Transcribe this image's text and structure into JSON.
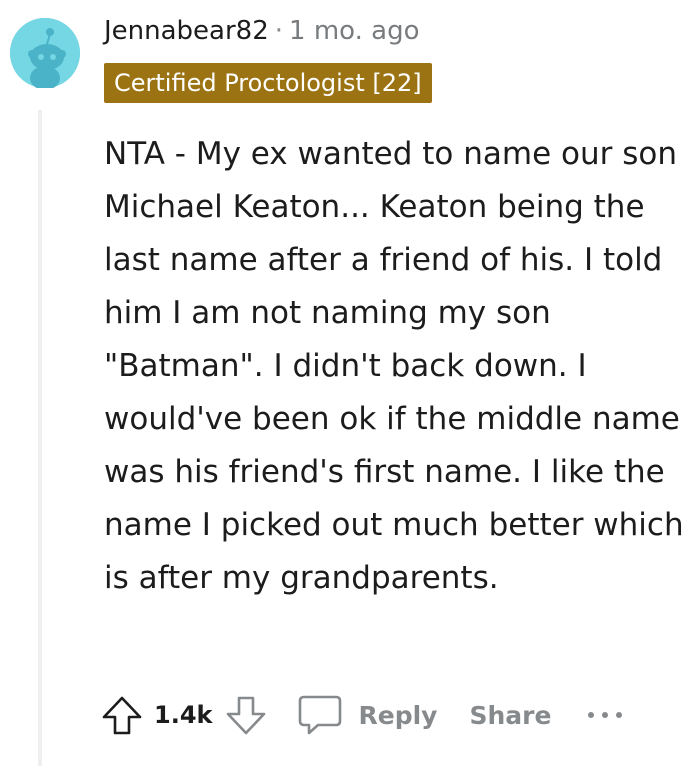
{
  "comment": {
    "username": "Jennabear82",
    "separator": "·",
    "timestamp": "1 mo. ago",
    "flair": "Certified Proctologist [22]",
    "body": "NTA - My ex wanted to name our son Michael Keaton... Keaton being the last name after a friend of his. I told him I am not naming my son \"Batman\". I didn't back down. I would've been ok if the middle name was his friend's first name. I like the name I picked out much better which is after my grandparents."
  },
  "actions": {
    "upvote_icon": "arrow-up-icon",
    "vote_count": "1.4k",
    "downvote_icon": "arrow-down-icon",
    "reply_icon": "chat-bubble-icon",
    "reply_label": "Reply",
    "share_label": "Share",
    "more_icon": "ellipsis-icon"
  },
  "colors": {
    "flair_bg": "#9b7312",
    "avatar_bg": "#6fd3e3",
    "muted": "#878a8c"
  }
}
